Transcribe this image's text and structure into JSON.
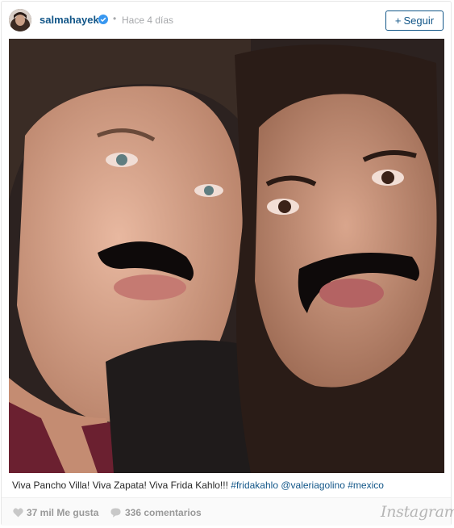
{
  "header": {
    "username": "salmahayek",
    "separator": "•",
    "timestamp": "Hace 4 días",
    "follow_label": "Seguir",
    "follow_plus": "+"
  },
  "caption": {
    "text": "Viva Pancho Villa! Viva Zapata! Viva Frida Kahlo!!! ",
    "tag1": "#fridakahlo",
    "mention": "@valeriagolino",
    "tag2": "#mexico"
  },
  "footer": {
    "likes": "37 mil Me gusta",
    "comments": "336 comentarios",
    "brand": "Instagram"
  },
  "colors": {
    "link_blue": "#125688",
    "verified_blue": "#3897f0",
    "meta_gray": "#a5a7aa"
  },
  "icons": [
    "verified-badge-icon",
    "heart-icon",
    "comment-bubble-icon",
    "instagram-logo"
  ]
}
